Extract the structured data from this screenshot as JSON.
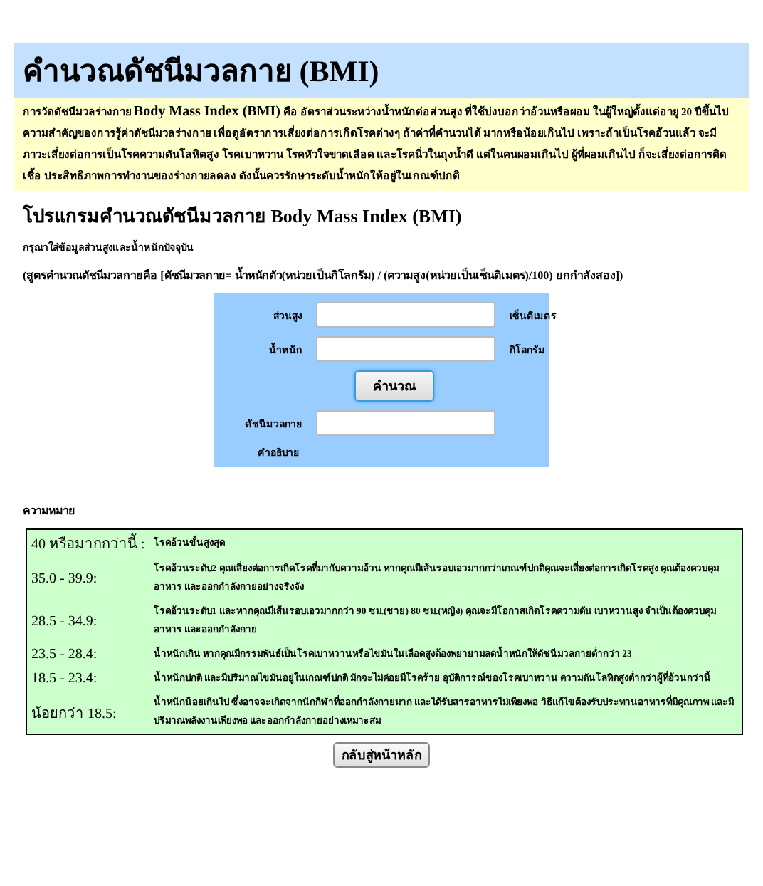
{
  "title": "คำนวณดัชนีมวลกาย (BMI)",
  "intro": "การวัดดัชนีมวลร่างกาย **Body Mass Index (BMI)** คือ อัตราส่วนระหว่างน้ำหนักต่อส่วนสูง ที่ใช้บ่งบอกว่าอ้วนหรือผอม ในผู้ใหญ่ตั้งแต่อายุ 20 ปีขึ้นไป ความสำคัญของการรู้ค่าดัชนีมวลร่างกาย เพื่อดูอัตราการเสี่ยงต่อการเกิดโรคต่างๆ ถ้าค่าที่คำนวนได้ มากหรือน้อยเกินไป เพราะถ้าเป็นโรคอ้วนแล้ว จะมีภาวะเสี่ยงต่อการเป็นโรคความดันโลหิตสูง โรคเบาหวาน โรคหัวใจขาดเลือด และโรคนิ่วในถุงน้ำดี แต่ในคนผอมเกินไป ผู้ที่ผอมเกินไป ก็จะเสี่ยงต่อการติดเชื้อ ประสิทธิภาพการทำงานของร่างกายลดลง ดังนั้นควรรักษาระดับน้ำหนักให้อยู่ในเกณฑ์ปกติ",
  "program_heading": "โปรแกรมคำนวณดัชนีมวลกาย Body Mass Index (BMI)",
  "instruction": "กรุณาใส่ข้อมูลส่วนสูงและน้ำหนักปัจจุบัน",
  "formula": "(สูตรคำนวณดัชนีมวลกายคือ [ดัชนีมวลกาย= น้ำหนักตัว(หน่วยเป็นกิโลกรัม) / (ความสูง(หน่วยเป็นเซ็นติเมตร)/100) ยกกำลังสอง])",
  "form": {
    "fields": [
      {
        "label": "ส่วนสูง",
        "unit": "เซ็นติเมตร"
      },
      {
        "label": "น้ำหนัก",
        "unit": "กิโลกรัม"
      }
    ],
    "button": "คำนวณ",
    "result_label": "ดัชนีมวลกาย",
    "description_label": "คำอธิบาย"
  },
  "meaning_heading": "ความหมาย",
  "meanings": [
    {
      "range": "40 หรือมากกว่านี้ :",
      "text": "โรคอ้วนขั้นสูงสุด"
    },
    {
      "range": "35.0 - 39.9:",
      "text": "โรคอ้วนระดับ2 คุณเสี่ยงต่อการเกิดโรคที่มากับความอ้วน หากคุณมีเส้นรอบเอวมากกว่าเกณฑ์ปกติคุณจะเสี่ยงต่อการเกิดโรคสูง คุณต้องควบคุมอาหาร และออกกำลังกายอย่างจริงจัง"
    },
    {
      "range": "28.5 - 34.9:",
      "text": "โรคอ้วนระดับ1 และหากคุณมีเส้นรอบเอวมากกว่า 90 ซม.(ชาย) 80 ซม.(หญิง) คุณจะมีโอกาสเกิดโรคความดัน เบาหวานสูง จำเป็นต้องควบคุมอาหาร และออกกำลังกาย"
    },
    {
      "range": "23.5 - 28.4:",
      "text": "น้ำหนักเกิน หากคุณมีกรรมพันธ์เป็นโรคเบาหวานหรือไขมันในเลือดสูงต้องพยายามลดน้ำหนักให้ดัชนีมวลกายต่ำกว่า 23"
    },
    {
      "range": "18.5 - 23.4:",
      "text": "น้ำหนักปกติ และมีปริมาณไขมันอยู่ในเกณฑ์ปกติ มักจะไม่ค่อยมีโรคร้าย อุบัติการณ์ของโรคเบาหวาน ความดันโลหิตสูงต่ำกว่าผู้ที่อ้วนกว่านี้"
    },
    {
      "range": "น้อยกว่า 18.5:",
      "text": "น้ำหนักน้อยเกินไป ซึ่งอาจจะเกิดจากนักกีฬาที่ออกกำลังกายมาก และได้รับสารอาหารไม่เพียงพอ วิธีแก้ไขต้องรับประทานอาหารที่มีคุณภาพ และมีปริมาณพลังงานเพียงพอ และออกกำลังกายอย่างเหมาะสม"
    }
  ],
  "back_button": "กลับสู่หน้าหลัก"
}
